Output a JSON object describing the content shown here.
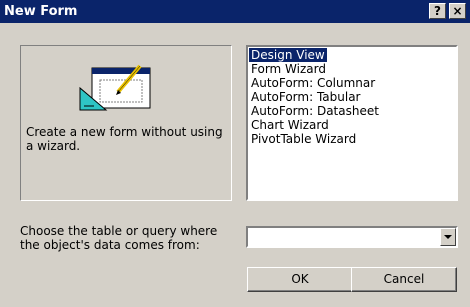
{
  "window": {
    "title": "New Form",
    "help_label": "?",
    "close_label": "×"
  },
  "preview": {
    "icon": "form-design-icon",
    "description": "Create a new form without using a wizard."
  },
  "options": [
    {
      "label": "Design View",
      "selected": true
    },
    {
      "label": "Form Wizard",
      "selected": false
    },
    {
      "label": "AutoForm: Columnar",
      "selected": false
    },
    {
      "label": "AutoForm: Tabular",
      "selected": false
    },
    {
      "label": "AutoForm: Datasheet",
      "selected": false
    },
    {
      "label": "Chart Wizard",
      "selected": false
    },
    {
      "label": "PivotTable Wizard",
      "selected": false
    }
  ],
  "source": {
    "label": "Choose the table or query where the object's data comes from:",
    "value": ""
  },
  "buttons": {
    "ok": "OK",
    "cancel": "Cancel"
  },
  "colors": {
    "titlebar": "#0a246a",
    "face": "#d4d0c8",
    "selection": "#0a246a"
  }
}
